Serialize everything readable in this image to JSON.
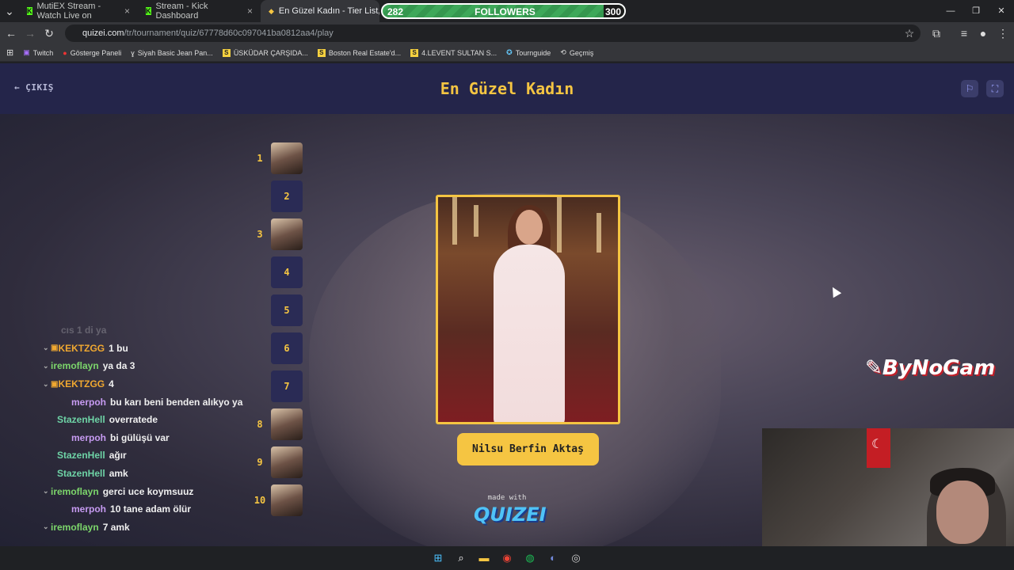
{
  "browser": {
    "tabs": [
      {
        "title": "MutiEX Stream - Watch Live on",
        "icon": "kick-icon"
      },
      {
        "title": "Stream - Kick Dashboard",
        "icon": "kick-icon"
      },
      {
        "title": "En Güzel Kadın - Tier List, Kör S",
        "icon": "quizei-icon"
      }
    ],
    "url_host": "quizei.com",
    "url_path": "/tr/tournament/quiz/67778d60c097041ba0812aa4/play",
    "bookmarks": [
      "Twitch",
      "Gösterge Paneli",
      "Siyah Basic Jean Pan...",
      "ÜSKÜDAR ÇARŞIDA...",
      "Boston Real Estate'd...",
      "4.LEVENT SULTAN S...",
      "Tournguide",
      "Geçmiş"
    ]
  },
  "overlay": {
    "followers_label": "FOLLOWERS",
    "followers_current": "282",
    "followers_goal": "300",
    "followers_progress": 0.94,
    "brand": "ByNoGam"
  },
  "quiz": {
    "exit_label": "ÇIKIŞ",
    "title": "En Güzel Kadın",
    "candidate_name": "Nilsu Berfin Aktaş",
    "made_with": "made with",
    "logo": "QUIZEI",
    "slots": [
      {
        "n": "1",
        "filled": true
      },
      {
        "n": "2",
        "filled": false
      },
      {
        "n": "3",
        "filled": true
      },
      {
        "n": "4",
        "filled": false
      },
      {
        "n": "5",
        "filled": false
      },
      {
        "n": "6",
        "filled": false
      },
      {
        "n": "7",
        "filled": false
      },
      {
        "n": "8",
        "filled": true
      },
      {
        "n": "9",
        "filled": true
      },
      {
        "n": "10",
        "filled": true
      }
    ]
  },
  "chat": [
    {
      "user": "",
      "msg": "cıs 1 di ya",
      "color": "orange",
      "faded": true,
      "chev": false
    },
    {
      "user": "KEKTZGG",
      "msg": "1 bu",
      "color": "orange",
      "faded": false,
      "chev": true
    },
    {
      "user": "iremoflayn",
      "msg": "ya da 3",
      "color": "green",
      "faded": false,
      "chev": true
    },
    {
      "user": "KEKTZGG",
      "msg": "4",
      "color": "orange",
      "faded": false,
      "chev": true
    },
    {
      "user": "merpoh",
      "msg": "bu karı beni benden alıkyo ya",
      "color": "purple",
      "faded": false,
      "chev": false
    },
    {
      "user": "StazenHell",
      "msg": "overratede",
      "color": "teal",
      "faded": false,
      "chev": false
    },
    {
      "user": "merpoh",
      "msg": "bi gülüşü var",
      "color": "purple",
      "faded": false,
      "chev": false
    },
    {
      "user": "StazenHell",
      "msg": "ağır",
      "color": "teal",
      "faded": false,
      "chev": false
    },
    {
      "user": "StazenHell",
      "msg": "amk",
      "color": "teal",
      "faded": false,
      "chev": false
    },
    {
      "user": "iremoflayn",
      "msg": "gerci uce koymsuuz",
      "color": "green",
      "faded": false,
      "chev": true
    },
    {
      "user": "merpoh",
      "msg": "10 tane adam ölür",
      "color": "purple",
      "faded": false,
      "chev": false
    },
    {
      "user": "iremoflayn",
      "msg": "7 amk",
      "color": "green",
      "faded": false,
      "chev": true
    }
  ],
  "colors": {
    "accent": "#f5c542",
    "page_bg": "#262744"
  }
}
